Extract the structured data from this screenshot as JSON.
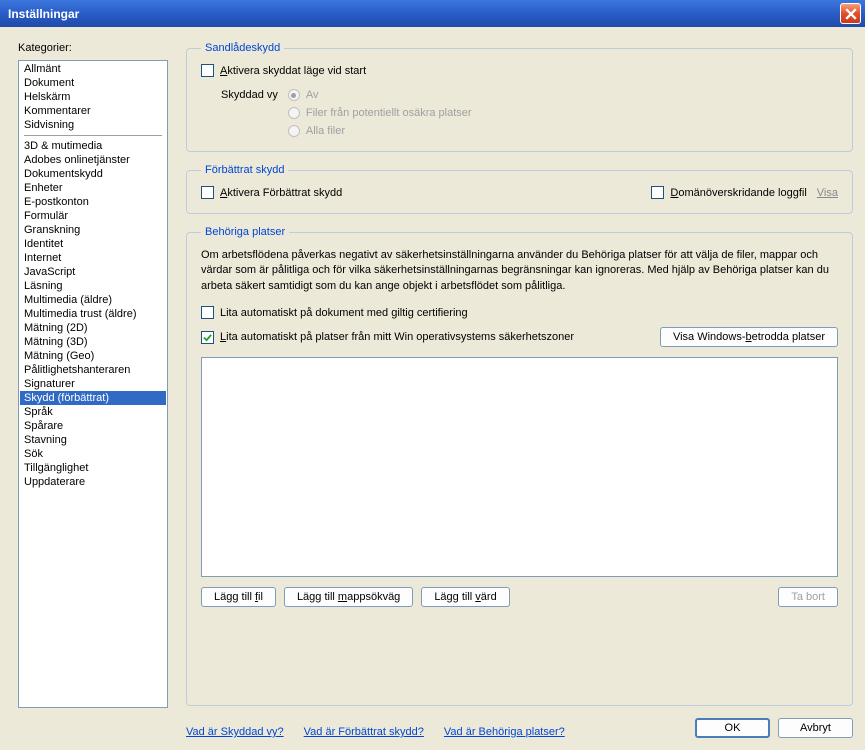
{
  "window": {
    "title": "Inställningar"
  },
  "sidebar": {
    "label": "Kategorier:",
    "group1": [
      "Allmänt",
      "Dokument",
      "Helskärm",
      "Kommentarer",
      "Sidvisning"
    ],
    "group2": [
      "3D & mutimedia",
      "Adobes onlinetjänster",
      "Dokumentskydd",
      "Enheter",
      "E-postkonton",
      "Formulär",
      "Granskning",
      "Identitet",
      "Internet",
      "JavaScript",
      "Läsning",
      "Multimedia (äldre)",
      "Multimedia trust (äldre)",
      "Mätning (2D)",
      "Mätning (3D)",
      "Mätning (Geo)",
      "Pålitlighetshanteraren",
      "Signaturer",
      "Skydd (förbättrat)",
      "Språk",
      "Spårare",
      "Stavning",
      "Sök",
      "Tillgänglighet",
      "Uppdaterare"
    ],
    "selected": "Skydd (förbättrat)"
  },
  "sandbox": {
    "legend": "Sandlådeskydd",
    "enable_protected_start": "Aktivera skyddat läge vid start",
    "protected_view_label": "Skyddad vy",
    "options": {
      "off": "Av",
      "unsafe": "Filer från potentiellt osäkra platser",
      "all": "Alla filer"
    }
  },
  "enhanced": {
    "legend": "Förbättrat skydd",
    "enable": "Aktivera Förbättrat skydd",
    "cross_domain_log": "Domänöverskridande loggfil",
    "visa": "Visa"
  },
  "privileged": {
    "legend": "Behöriga platser",
    "info": "Om arbetsflödena påverkas negativt av säkerhetsinställningarna använder du Behöriga platser för att välja de filer, mappar och värdar som är pålitliga och för vilka säkerhetsinställningarnas begränsningar kan ignoreras. Med hjälp av Behöriga platser kan du arbeta säkert samtidigt som du kan ange objekt i arbetsflödet som pålitliga.",
    "trust_cert_docs": "Lita automatiskt på dokument med giltig certifiering",
    "trust_os_zones": "Lita automatiskt på platser från mitt Win operativsystems säkerhetszoner",
    "view_win_trusted": "Visa Windows-betrodda platser",
    "add_file": "Lägg till fil",
    "add_folder": "Lägg till mappsökväg",
    "add_host": "Lägg till värd",
    "remove": "Ta bort"
  },
  "links": {
    "protected_view": "Vad är Skyddad vy?",
    "enhanced": "Vad är Förbättrat skydd?",
    "privileged": "Vad är Behöriga platser?"
  },
  "footer": {
    "ok": "OK",
    "cancel": "Avbryt"
  }
}
